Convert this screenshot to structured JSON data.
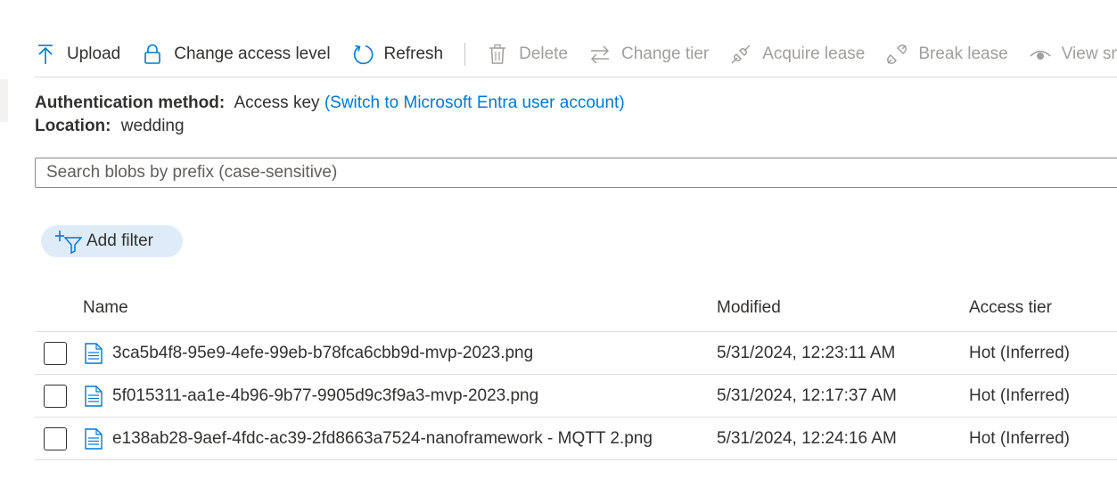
{
  "toolbar": {
    "items": [
      {
        "label": "Upload",
        "icon": "upload-icon",
        "disabled": false
      },
      {
        "label": "Change access level",
        "icon": "lock-icon",
        "disabled": false
      },
      {
        "label": "Refresh",
        "icon": "refresh-icon",
        "disabled": false
      },
      {
        "label": "Delete",
        "icon": "trash-icon",
        "disabled": true
      },
      {
        "label": "Change tier",
        "icon": "swap-arrows-icon",
        "disabled": true
      },
      {
        "label": "Acquire lease",
        "icon": "plug-icon",
        "disabled": true
      },
      {
        "label": "Break lease",
        "icon": "unplug-icon",
        "disabled": true
      },
      {
        "label": "View sn",
        "icon": "eye-icon",
        "disabled": true
      }
    ]
  },
  "info": {
    "auth_label": "Authentication method:",
    "auth_value": "Access key",
    "auth_link": "(Switch to Microsoft Entra user account)",
    "location_label": "Location:",
    "location_value": "wedding"
  },
  "search": {
    "placeholder": "Search blobs by prefix (case-sensitive)",
    "value": ""
  },
  "filter": {
    "label": "Add filter"
  },
  "table": {
    "columns": [
      "Name",
      "Modified",
      "Access tier"
    ],
    "rows": [
      {
        "name": "3ca5b4f8-95e9-4efe-99eb-b78fca6cbb9d-mvp-2023.png",
        "modified": "5/31/2024, 12:23:11 AM",
        "tier": "Hot (Inferred)"
      },
      {
        "name": "5f015311-aa1e-4b96-9b77-9905d9c3f9a3-mvp-2023.png",
        "modified": "5/31/2024, 12:17:37 AM",
        "tier": "Hot (Inferred)"
      },
      {
        "name": "e138ab28-9aef-4fdc-ac39-2fd8663a7524-nanoframework - MQTT 2.png",
        "modified": "5/31/2024, 12:24:16 AM",
        "tier": "Hot (Inferred)"
      }
    ]
  },
  "colors": {
    "accent": "#0078d4",
    "disabled": "#a19f9d",
    "pill": "#deecf9"
  }
}
